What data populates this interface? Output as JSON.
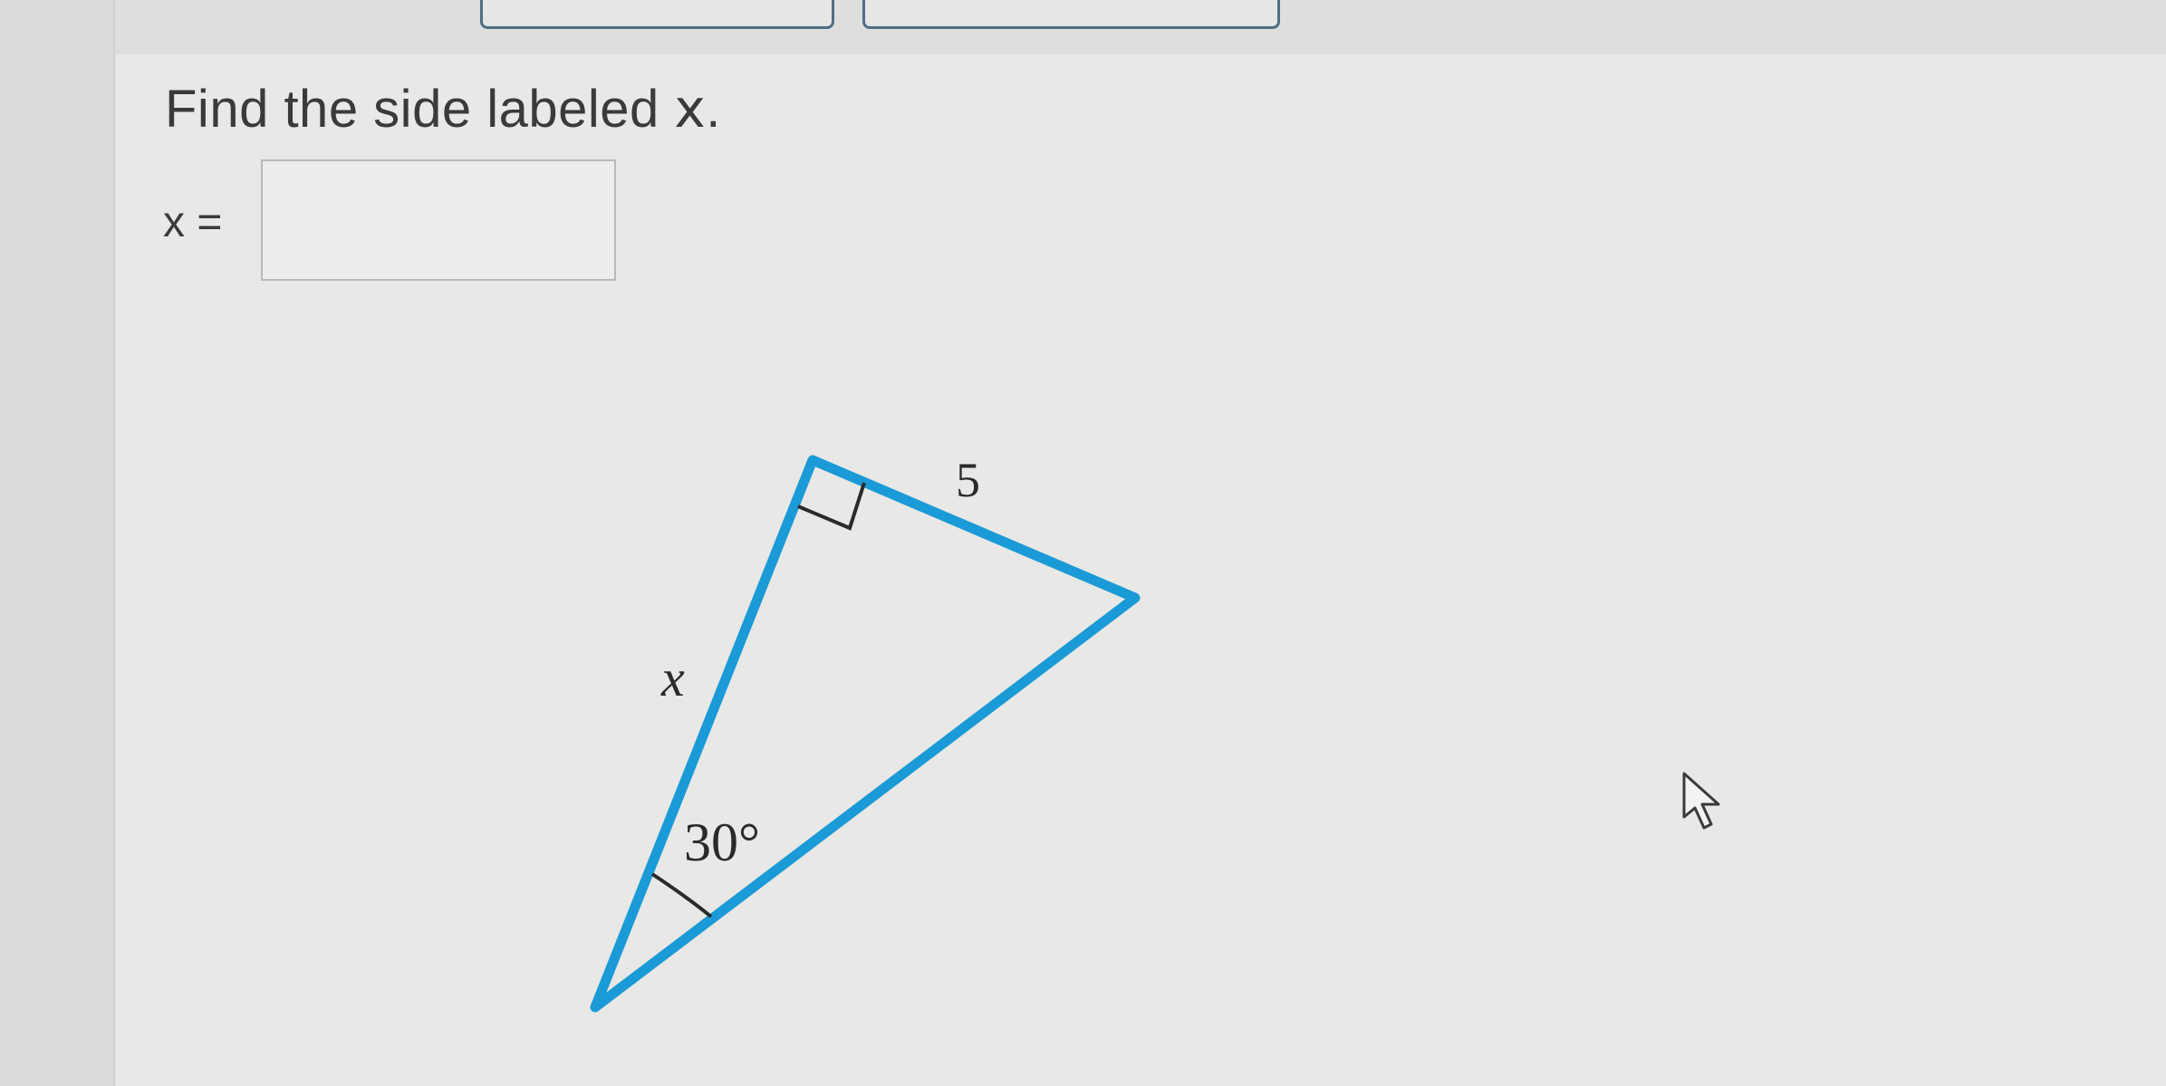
{
  "question": {
    "prompt_prefix": "Find the side labeled ",
    "prompt_variable": "x",
    "prompt_suffix": ".",
    "answer_label": "x =",
    "answer_value": ""
  },
  "figure": {
    "side_label": "x",
    "hypotenuse_label": "5",
    "angle_label": "30°",
    "stroke_color": "#1a9ad6"
  }
}
